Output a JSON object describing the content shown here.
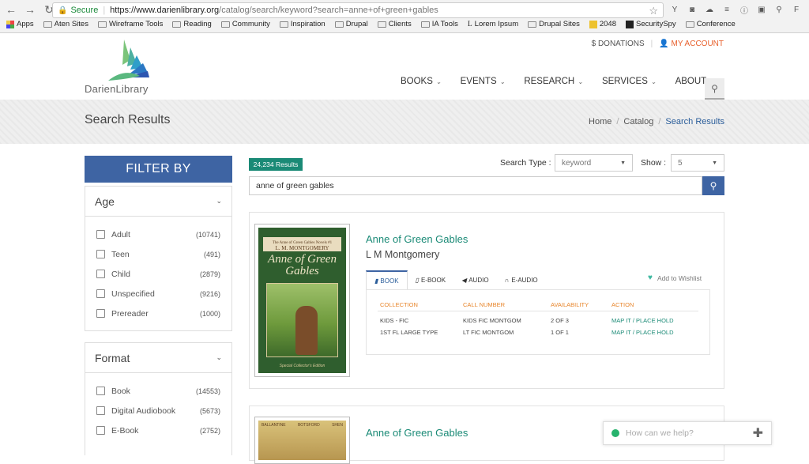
{
  "browser": {
    "secure_label": "Secure",
    "url_host": "https://www.darienlibrary.org",
    "url_path": "/catalog/search/keyword?search=anne+of+green+gables",
    "bookmarks": [
      "Apps",
      "Aten Sites",
      "Wireframe Tools",
      "Reading",
      "Community",
      "Inspiration",
      "Drupal",
      "Clients",
      "IA Tools",
      "Lorem Ipsum",
      "Drupal Sites",
      "2048",
      "SecuritySpy",
      "Conference"
    ]
  },
  "header": {
    "donations": "DONATIONS",
    "my_account": "MY ACCOUNT",
    "logo_text": "DarienLibrary",
    "nav": [
      "BOOKS",
      "EVENTS",
      "RESEARCH",
      "SERVICES",
      "ABOUT"
    ]
  },
  "banner": {
    "title": "Search Results",
    "breadcrumbs": [
      "Home",
      "Catalog",
      "Search Results"
    ]
  },
  "filter": {
    "heading": "FILTER BY",
    "age": {
      "title": "Age",
      "items": [
        {
          "label": "Adult",
          "count": "(10741)"
        },
        {
          "label": "Teen",
          "count": "(491)"
        },
        {
          "label": "Child",
          "count": "(2879)"
        },
        {
          "label": "Unspecified",
          "count": "(9216)"
        },
        {
          "label": "Prereader",
          "count": "(1000)"
        }
      ]
    },
    "format": {
      "title": "Format",
      "items": [
        {
          "label": "Book",
          "count": "(14553)"
        },
        {
          "label": "Digital Audiobook",
          "count": "(5673)"
        },
        {
          "label": "E-Book",
          "count": "(2752)"
        }
      ]
    }
  },
  "search": {
    "results_count": "24,234 Results",
    "search_type_label": "Search Type :",
    "search_type_value": "keyword",
    "show_label": "Show :",
    "show_value": "5",
    "query": "anne of green gables"
  },
  "results": [
    {
      "title": "Anne of Green Gables",
      "author": "L M Montgomery",
      "cover": {
        "series": "The Anne of Green Gables Novels #1",
        "author": "L. M. MONTGOMERY",
        "title": "Anne of Green Gables",
        "edition": "Special Collector's Edition"
      },
      "tabs": [
        "BOOK",
        "E-BOOK",
        "AUDIO",
        "E-AUDIO"
      ],
      "wishlist": "Add to Wishlist",
      "columns": [
        "COLLECTION",
        "CALL NUMBER",
        "AVAILABILITY",
        "ACTION"
      ],
      "rows": [
        {
          "collection": "KIDS - FIC",
          "call": "KIDS FIC MONTGOM",
          "avail": "2 OF 3",
          "action": "MAP IT / PLACE HOLD"
        },
        {
          "collection": "1ST FL LARGE TYPE",
          "call": "LT FIC MONTGOM",
          "avail": "1 OF 1",
          "action": "MAP IT / PLACE HOLD"
        }
      ]
    },
    {
      "title": "Anne of Green Gables",
      "cover": {
        "names": [
          "BALLANTINE",
          "BOTSFORD",
          "SHEN"
        ]
      }
    }
  ],
  "chat": {
    "placeholder": "How can we help?"
  },
  "colors": {
    "brand_blue": "#3e64a3",
    "teal": "#1a8a76",
    "orange": "#e8862c"
  }
}
